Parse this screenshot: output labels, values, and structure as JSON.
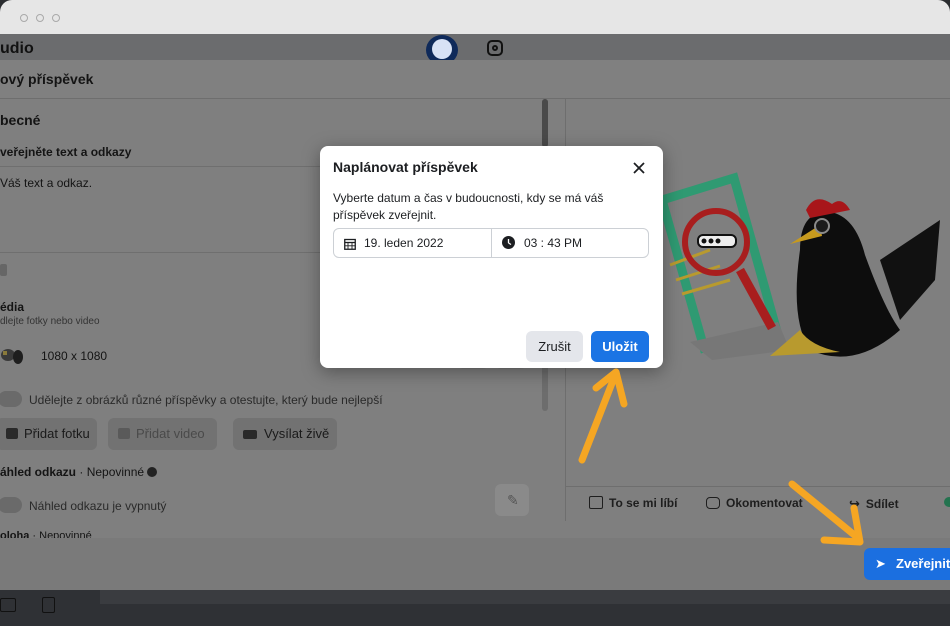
{
  "app": {
    "title_fragment": "udio"
  },
  "header": {
    "title": "ový příspěvek"
  },
  "left": {
    "general_heading": "becné",
    "text_section_label": "veřejněte text a odkazy",
    "text_placeholder": "Váš text a odkaz.",
    "media_heading": "édia",
    "media_subtitle": "dlejte fotky nebo video",
    "media_size": "1080 x 1080",
    "ab_test_label": "Udělejte z obrázků různé příspěvky a otestujte, který bude nejlepší",
    "add_photo_label": "Přidat fotku",
    "add_video_label": "Přidat video",
    "live_label": "Vysílat živě",
    "link_preview_heading": "áhled odkazu",
    "link_preview_optional": "· Nepovinné",
    "link_preview_toggle_label": "Náhled odkazu je vypnutý",
    "location_heading": "oloha",
    "location_optional": "· Nepovinné"
  },
  "preview": {
    "like_label": "To se mi líbí",
    "comment_label": "Okomentovat",
    "share_label": "Sdílet"
  },
  "publish": {
    "label": "Zveřejnit"
  },
  "modal": {
    "title": "Naplánovat příspěvek",
    "description_line1": "Vyberte datum a čas v budoucnosti, kdy se má váš",
    "description_line2": "příspěvek zveřejnit.",
    "date": "19. leden 2022",
    "time": "03 : 43 PM",
    "cancel_label": "Zrušit",
    "save_label": "Uložit"
  },
  "colors": {
    "accent": "#1b74e4",
    "arrow": "#f5a623",
    "overlay": "#7f7f7f"
  }
}
